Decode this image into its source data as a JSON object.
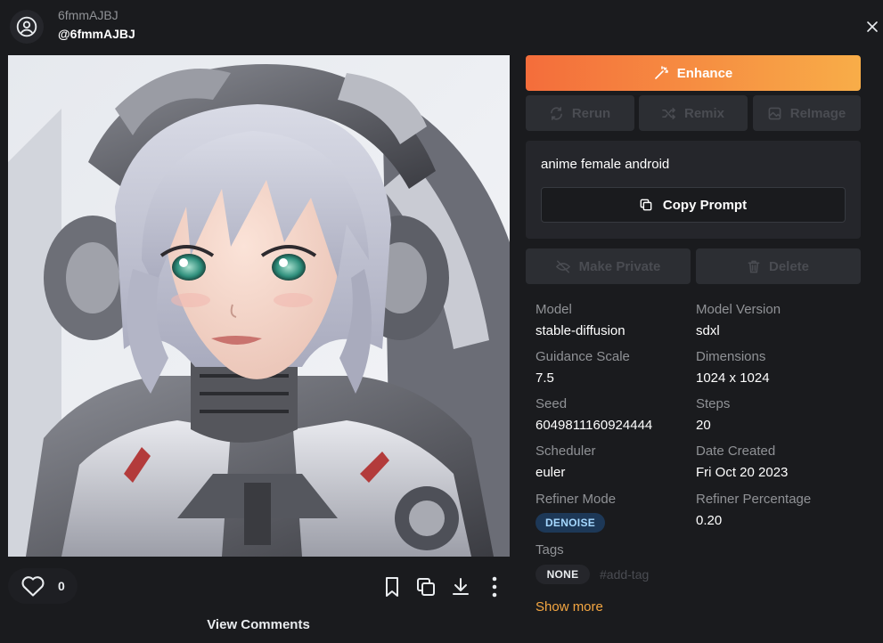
{
  "header": {
    "username": "6fmmAJBJ",
    "handle": "@6fmmAJBJ"
  },
  "image": {
    "alt": "anime female android"
  },
  "actions": {
    "like_count": "0",
    "view_comments": "View Comments"
  },
  "panel": {
    "enhance_label": "Enhance",
    "rerun_label": "Rerun",
    "remix_label": "Remix",
    "reimage_label": "ReImage",
    "prompt": "anime female android",
    "copy_prompt_label": "Copy Prompt",
    "make_private_label": "Make Private",
    "delete_label": "Delete"
  },
  "meta": {
    "model_label": "Model",
    "model_value": "stable-diffusion",
    "model_version_label": "Model Version",
    "model_version_value": "sdxl",
    "guidance_label": "Guidance Scale",
    "guidance_value": "7.5",
    "dimensions_label": "Dimensions",
    "dimensions_value": "1024 x 1024",
    "seed_label": "Seed",
    "seed_value": "6049811160924444",
    "steps_label": "Steps",
    "steps_value": "20",
    "scheduler_label": "Scheduler",
    "scheduler_value": "euler",
    "date_label": "Date Created",
    "date_value": "Fri Oct 20 2023",
    "refiner_mode_label": "Refiner Mode",
    "refiner_mode_value": "DENOISE",
    "refiner_pct_label": "Refiner Percentage",
    "refiner_pct_value": "0.20",
    "tags_label": "Tags",
    "tag_none": "NONE",
    "add_tag_placeholder": "#add-tag",
    "show_more": "Show more"
  },
  "colors": {
    "background": "#1a1b1e",
    "accent_start": "#f46d3b",
    "accent_end": "#f8ad48",
    "show_more": "#f5a742",
    "badge_denoise_bg": "#1d3857",
    "badge_denoise_text": "#a5d8ff"
  },
  "icons": [
    "user-circle-icon",
    "close-icon",
    "heart-icon",
    "bookmark-icon",
    "copy-icon",
    "download-icon",
    "more-vertical-icon",
    "wand-icon",
    "refresh-icon",
    "shuffle-icon",
    "photo-icon",
    "eye-off-icon",
    "trash-icon"
  ]
}
